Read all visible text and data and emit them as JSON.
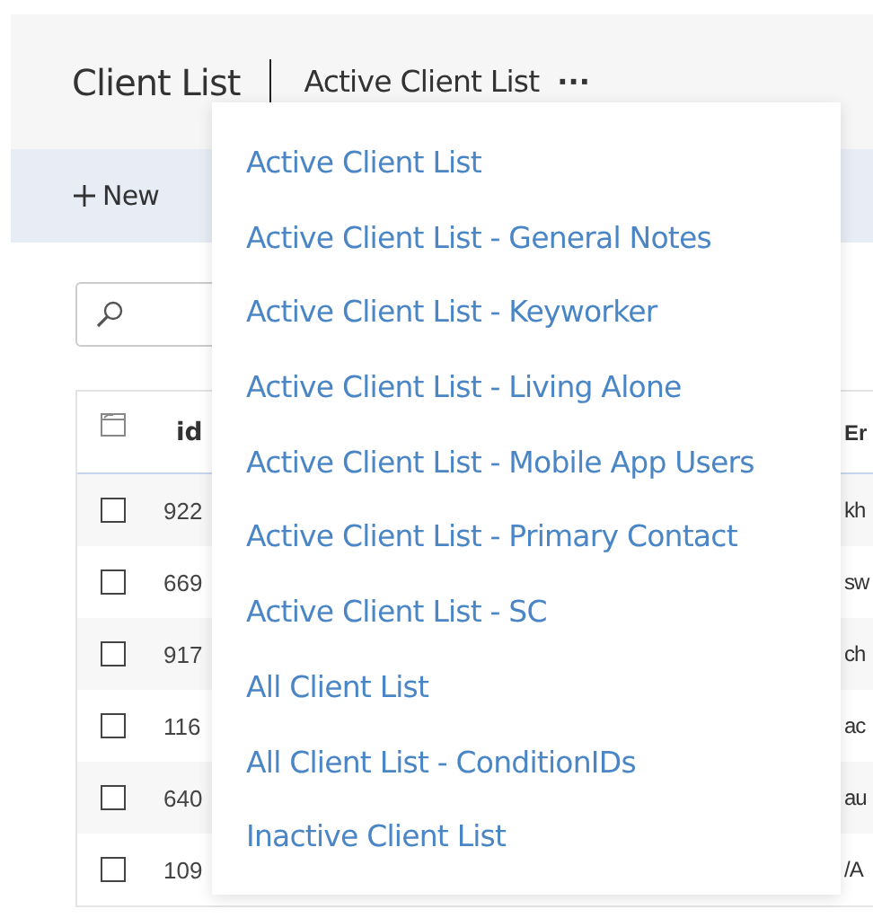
{
  "header": {
    "title": "Client List",
    "view_name": "Active Client List",
    "more": "···"
  },
  "toolbar": {
    "new_button": "New"
  },
  "table": {
    "columns": [
      "id",
      "Er"
    ],
    "rows": [
      {
        "id": "922",
        "column_2": "kh",
        "checked": false
      },
      {
        "id": "669",
        "column_2": "sw",
        "checked": false
      },
      {
        "id": "917",
        "column_2": "ch",
        "checked": false
      },
      {
        "id": "116",
        "column_2": "ac",
        "checked": false
      },
      {
        "id": "640",
        "column_2": "au",
        "checked": false
      },
      {
        "id": "109",
        "column_2": "/A",
        "checked": false
      }
    ]
  },
  "view_menu": {
    "items": [
      "Active Client List",
      "Active Client List - General Notes",
      "Active Client List - Keyworker",
      "Active Client List - Living Alone",
      "Active Client List - Mobile App Users",
      "Active Client List - Primary Contact",
      "Active Client List - SC",
      "All Client List",
      "All Client List - ConditionIDs",
      "Inactive Client List"
    ]
  }
}
